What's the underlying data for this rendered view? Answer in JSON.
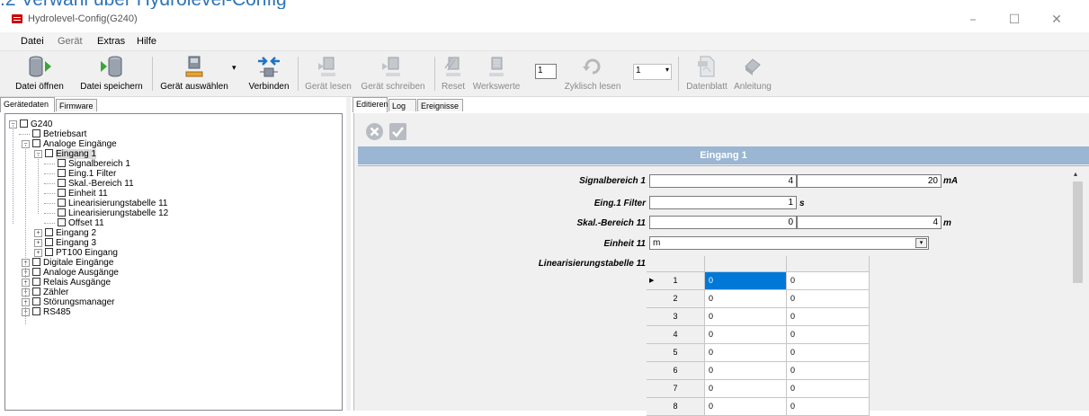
{
  "doc_heading": ".2   Verwahl über Hydrolevel-Config",
  "window": {
    "title": "Hydrolevel-Config(G240)",
    "controls": {
      "minimize": "–",
      "maximize": "☐",
      "close": "✕"
    }
  },
  "menu": {
    "items": [
      "Datei",
      "Gerät",
      "Extras",
      "Hilfe"
    ]
  },
  "toolbar": {
    "buttons": [
      {
        "label": "Datei öffnen",
        "icon": "open-database-icon"
      },
      {
        "label": "Datei speichern",
        "icon": "save-database-icon"
      },
      {
        "label": "Gerät auswählen",
        "icon": "select-device-icon"
      },
      {
        "label": "Verbinden",
        "icon": "connect-arrows-icon"
      },
      {
        "label": "Gerät lesen",
        "icon": "device-read-icon"
      },
      {
        "label": "Gerät schreiben",
        "icon": "device-write-icon"
      },
      {
        "label": "Reset",
        "icon": "reset-icon"
      },
      {
        "label": "Werkswerte",
        "icon": "factory-values-icon"
      },
      {
        "label": "Zyklisch lesen",
        "icon": "cyclic-read-icon"
      },
      {
        "label": "Datenblatt",
        "icon": "pdf-datasheet-icon"
      },
      {
        "label": "Anleitung",
        "icon": "manual-icon"
      }
    ],
    "select_device_arrow": "▾",
    "cycle_field_value": "1",
    "combo_value": "1",
    "combo_arrow": "▾"
  },
  "left_tabs": [
    "Gerätedaten",
    "Firmware"
  ],
  "right_tabs": [
    "Editieren",
    "Log",
    "Ereignisse"
  ],
  "tree": {
    "expander_open": "−",
    "expander_closed": "+",
    "items": [
      {
        "label": "G240",
        "level": 0,
        "expander": "−"
      },
      {
        "label": "Betriebsart",
        "level": 1,
        "expander": ""
      },
      {
        "label": "Analoge Eingänge",
        "level": 1,
        "expander": "−"
      },
      {
        "label": "Eingang 1",
        "level": 2,
        "expander": "−",
        "selected": true
      },
      {
        "label": "Signalbereich 1",
        "level": 3,
        "expander": ""
      },
      {
        "label": "Eing.1 Filter",
        "level": 3,
        "expander": ""
      },
      {
        "label": "Skal.-Bereich 11",
        "level": 3,
        "expander": ""
      },
      {
        "label": "Einheit 11",
        "level": 3,
        "expander": ""
      },
      {
        "label": "Linearisierungstabelle 11",
        "level": 3,
        "expander": ""
      },
      {
        "label": "Linearisierungstabelle 12",
        "level": 3,
        "expander": ""
      },
      {
        "label": "Offset 11",
        "level": 3,
        "expander": ""
      },
      {
        "label": "Eingang 2",
        "level": 2,
        "expander": "+"
      },
      {
        "label": "Eingang 3",
        "level": 2,
        "expander": "+"
      },
      {
        "label": "PT100 Eingang",
        "level": 2,
        "expander": "+"
      },
      {
        "label": "Digitale Eingänge",
        "level": 1,
        "expander": "+"
      },
      {
        "label": "Analoge Ausgänge",
        "level": 1,
        "expander": "+"
      },
      {
        "label": "Relais Ausgänge",
        "level": 1,
        "expander": "+"
      },
      {
        "label": "Zähler",
        "level": 1,
        "expander": "+"
      },
      {
        "label": "Störungsmanager",
        "level": 1,
        "expander": "+"
      },
      {
        "label": "RS485",
        "level": 1,
        "expander": "+"
      }
    ]
  },
  "editor": {
    "header": "Eingang 1",
    "fields": {
      "signalbereich": {
        "label": "Signalbereich 1",
        "min": "4",
        "max": "20",
        "unit": "mA"
      },
      "filter": {
        "label": "Eing.1 Filter",
        "value": "1",
        "unit": "s"
      },
      "skal": {
        "label": "Skal.-Bereich 11",
        "min": "0",
        "max": "4",
        "unit": "m"
      },
      "einheit": {
        "label": "Einheit 11",
        "value": "m",
        "arrow": "▾"
      },
      "lin": {
        "label": "Linearisierungstabelle 11"
      }
    },
    "table": {
      "row_marker": "▶",
      "rows": [
        {
          "n": "1",
          "x": "0",
          "y": "0"
        },
        {
          "n": "2",
          "x": "0",
          "y": "0"
        },
        {
          "n": "3",
          "x": "0",
          "y": "0"
        },
        {
          "n": "4",
          "x": "0",
          "y": "0"
        },
        {
          "n": "5",
          "x": "0",
          "y": "0"
        },
        {
          "n": "6",
          "x": "0",
          "y": "0"
        },
        {
          "n": "7",
          "x": "0",
          "y": "0"
        },
        {
          "n": "8",
          "x": "0",
          "y": "0"
        }
      ]
    },
    "scroll_up_arrow": "▴"
  }
}
